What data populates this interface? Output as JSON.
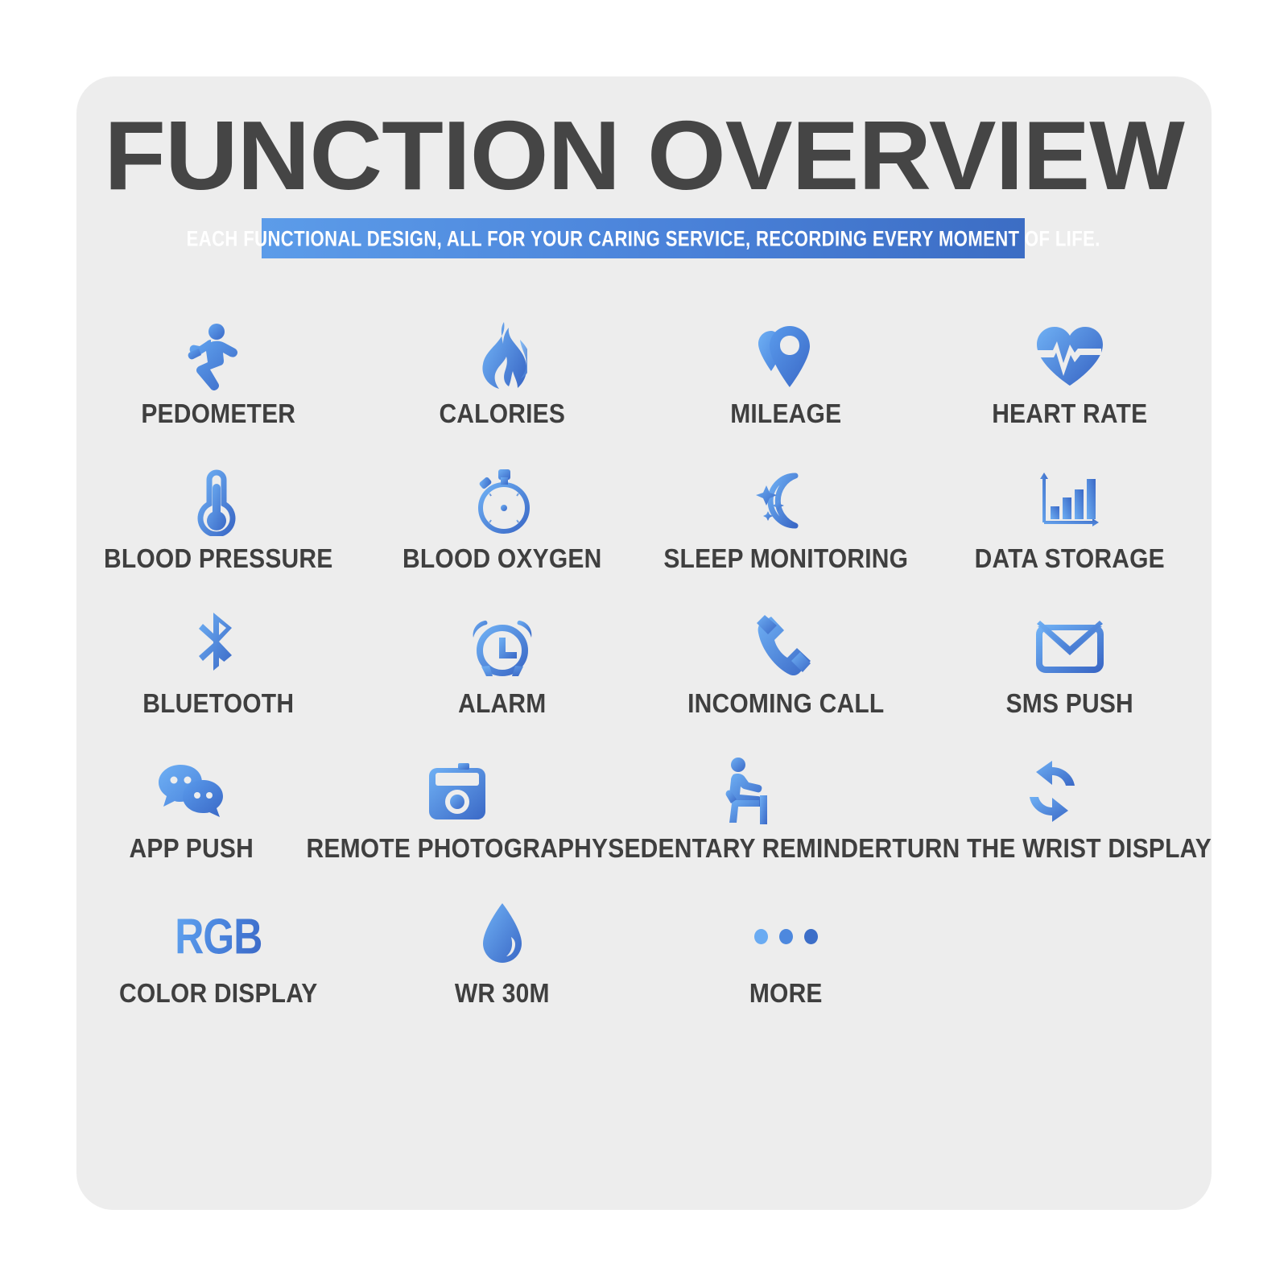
{
  "theme": {
    "page_background": "#ffffff",
    "card_background": "#ededed",
    "label_color": "#3f3f3f",
    "title_color": "#454545",
    "accent_light": "#61a4f0",
    "accent_dark": "#3a68c6",
    "banner_gradient_from": "#5c9ce9",
    "banner_gradient_to": "#3c6dc4"
  },
  "header": {
    "title": "FUNCTION OVERVIEW",
    "subtitle": "EACH FUNCTIONAL DESIGN, ALL FOR YOUR CARING SERVICE, RECORDING EVERY MOMENT OF LIFE."
  },
  "features": {
    "columns": 4,
    "rows": [
      [
        {
          "icon": "running-person-icon",
          "label": "PEDOMETER"
        },
        {
          "icon": "flame-icon",
          "label": "CALORIES"
        },
        {
          "icon": "map-pins-icon",
          "label": "MILEAGE"
        },
        {
          "icon": "heart-pulse-icon",
          "label": "HEART RATE"
        }
      ],
      [
        {
          "icon": "thermometer-icon",
          "label": "BLOOD PRESSURE"
        },
        {
          "icon": "stopwatch-icon",
          "label": "BLOOD OXYGEN"
        },
        {
          "icon": "moon-stars-icon",
          "label": "SLEEP MONITORING"
        },
        {
          "icon": "bar-chart-icon",
          "label": "DATA STORAGE"
        }
      ],
      [
        {
          "icon": "bluetooth-icon",
          "label": "BLUETOOTH"
        },
        {
          "icon": "alarm-clock-icon",
          "label": "ALARM"
        },
        {
          "icon": "phone-handset-icon",
          "label": "INCOMING CALL"
        },
        {
          "icon": "envelope-icon",
          "label": "SMS PUSH"
        }
      ],
      [
        {
          "icon": "chat-bubbles-icon",
          "label": "APP PUSH"
        },
        {
          "icon": "camera-icon",
          "label": "REMOTE PHOTOGRAPHY"
        },
        {
          "icon": "seated-person-icon",
          "label": "SEDENTARY REMINDER"
        },
        {
          "icon": "refresh-arrows-icon",
          "label": "TURN THE WRIST DISPLAY"
        }
      ],
      [
        {
          "icon": "rgb-text-icon",
          "label": "COLOR DISPLAY",
          "glyph_text": "RGB"
        },
        {
          "icon": "water-drop-icon",
          "label": "WR 30M"
        },
        {
          "icon": "three-dots-icon",
          "label": "MORE"
        },
        {
          "icon": "",
          "label": ""
        }
      ]
    ]
  }
}
